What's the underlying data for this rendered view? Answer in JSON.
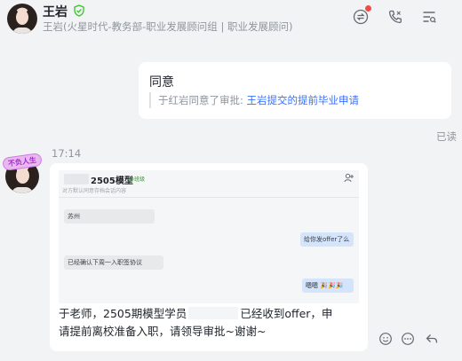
{
  "header": {
    "name": "王岩",
    "subtitle": "王岩(火星时代-教务部-职业发展顾问组 | 职业发展顾问)"
  },
  "approval_message": {
    "title": "同意",
    "quote_prefix": "于红岩同意了审批: ",
    "quote_link": "王岩提交的提前毕业申请",
    "read_status": "已读"
  },
  "timestamp": "17:14",
  "avatar_badge": "不负人生",
  "message": {
    "screenshot": {
      "title": "2505模型",
      "tag": "@班级",
      "description": "对方默认同意存档会话内容",
      "bubbles": [
        {
          "text": "苏州",
          "side": "left"
        },
        {
          "text": "给你发offer了么",
          "side": "right"
        },
        {
          "text": "已经确认下周一入职签协议",
          "side": "left"
        },
        {
          "text": "嗯嗯 🎉🎉🎉",
          "side": "right"
        }
      ]
    },
    "line1_before": "于老师，2505期模型学员",
    "line1_after": "已经收到offer，申",
    "line2": "请提前离校准备入职，请领导审批~谢谢~"
  },
  "colors": {
    "background": "#f2f3f5",
    "bubble": "#ffffff",
    "link": "#3370ff",
    "muted": "#8f959e",
    "notification": "#f54a45"
  },
  "icons": [
    "verified-shield-icon",
    "transfer-icon",
    "call-icon",
    "list-icon",
    "add-user-icon",
    "emoji-icon",
    "more-icon",
    "reply-icon"
  ]
}
